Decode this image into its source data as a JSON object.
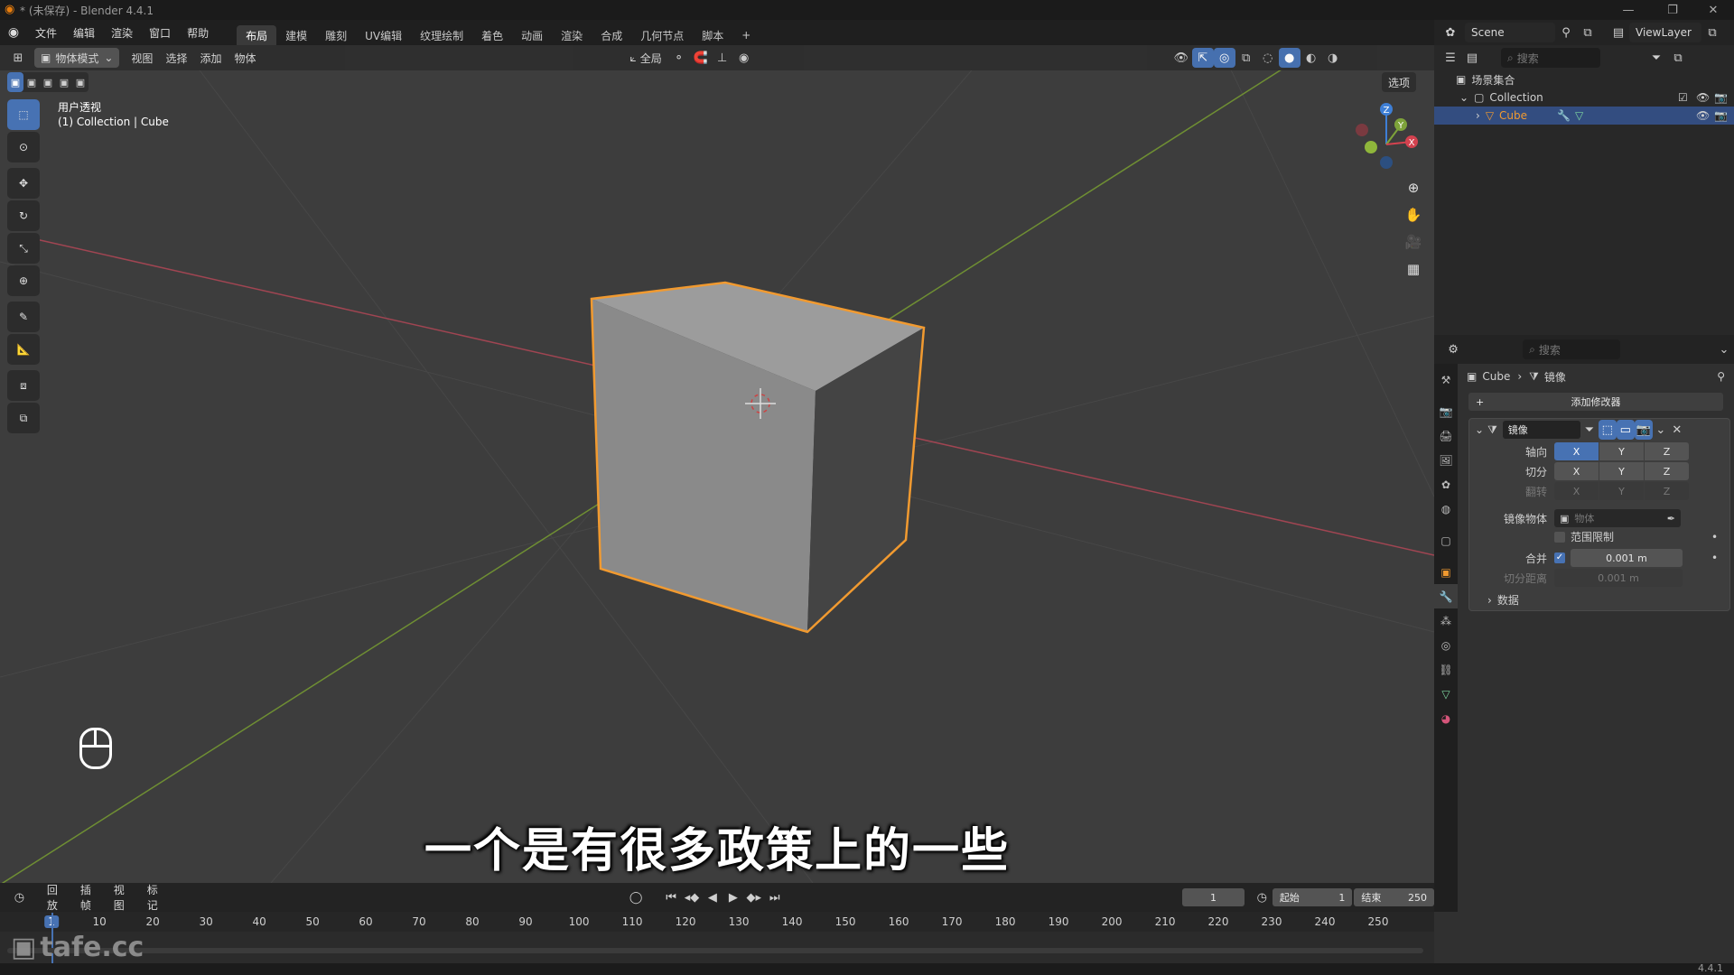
{
  "window": {
    "title": "* (未保存) - Blender 4.4.1"
  },
  "menu": {
    "items": [
      "文件",
      "编辑",
      "渲染",
      "窗口",
      "帮助"
    ]
  },
  "workspaces": [
    "布局",
    "建模",
    "雕刻",
    "UV编辑",
    "纹理绘制",
    "着色",
    "动画",
    "渲染",
    "合成",
    "几何节点",
    "脚本"
  ],
  "workspace_add": "+",
  "scene": {
    "name": "Scene",
    "view_layer": "ViewLayer"
  },
  "viewport_header": {
    "mode": "物体模式",
    "menus": [
      "视图",
      "选择",
      "添加",
      "物体"
    ],
    "transform_orientation": "全局",
    "options": "选项"
  },
  "viewport": {
    "view_name": "用户透视",
    "context": "(1) Collection | Cube",
    "subtitle": "一个是有很多政策上的一些",
    "gizmo": {
      "z": "Z",
      "y": "Y",
      "x": "X"
    }
  },
  "outliner": {
    "search_placeholder": "搜索",
    "scene_collection": "场景集合",
    "collection": "Collection",
    "object": "Cube"
  },
  "properties": {
    "search_placeholder": "搜索",
    "breadcrumb_object": "Cube",
    "breadcrumb_modifier": "镜像",
    "add_modifier": "添加修改器",
    "modifier_name": "镜像",
    "axis_label": "轴向",
    "bisect_label": "切分",
    "flip_label": "翻转",
    "axes": [
      "X",
      "Y",
      "Z"
    ],
    "mirror_object_label": "镜像物体",
    "mirror_object_placeholder": "物体",
    "clipping_label": "范围限制",
    "merge_label": "合并",
    "merge_value": "0.001 m",
    "bisect_distance_label": "切分距离",
    "bisect_distance_value": "0.001 m",
    "data_panel": "数据"
  },
  "timeline": {
    "menus": [
      "回放",
      "插帧",
      "视图",
      "标记"
    ],
    "current_frame": "1",
    "start_label": "起始",
    "start_value": "1",
    "end_label": "结束",
    "end_value": "250",
    "ticks": [
      "1",
      "10",
      "20",
      "30",
      "40",
      "50",
      "60",
      "70",
      "80",
      "90",
      "100",
      "110",
      "120",
      "130",
      "140",
      "150",
      "160",
      "170",
      "180",
      "190",
      "200",
      "210",
      "220",
      "230",
      "240",
      "250"
    ]
  },
  "status": {
    "version": "4.4.1"
  },
  "watermark": "tafe.cc",
  "colors": {
    "accent": "#4772b3",
    "selection_outline": "#f19a30",
    "x_axis": "#b34b57",
    "y_axis": "#7ea33a"
  }
}
